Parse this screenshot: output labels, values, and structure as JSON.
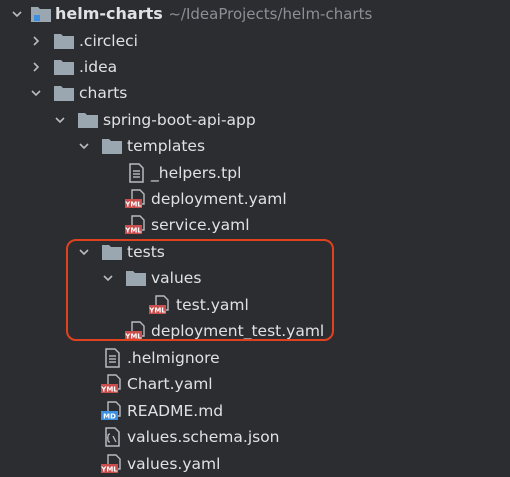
{
  "project": {
    "name": "helm-charts",
    "path": "~/IdeaProjects/helm-charts"
  },
  "tree": {
    "circleci": ".circleci",
    "idea": ".idea",
    "charts": "charts",
    "app": "spring-boot-api-app",
    "templates": "templates",
    "helpers": "_helpers.tpl",
    "deployment": "deployment.yaml",
    "service": "service.yaml",
    "tests": "tests",
    "values_dir": "values",
    "test_yaml": "test.yaml",
    "deployment_test": "deployment_test.yaml",
    "helmignore": ".helmignore",
    "chart": "Chart.yaml",
    "readme": "README.md",
    "schema": "values.schema.json",
    "values_yaml": "values.yaml"
  },
  "icon_badges": {
    "yml": "YML",
    "md": "MD"
  },
  "colors": {
    "background": "#2b2d30",
    "text": "#dfe1e5",
    "path_text": "#8c8f94",
    "folder": "#9aa7b0",
    "yml_badge": "#c94f4f",
    "md_badge": "#3d8fe0",
    "highlight_border": "#e0421f"
  }
}
